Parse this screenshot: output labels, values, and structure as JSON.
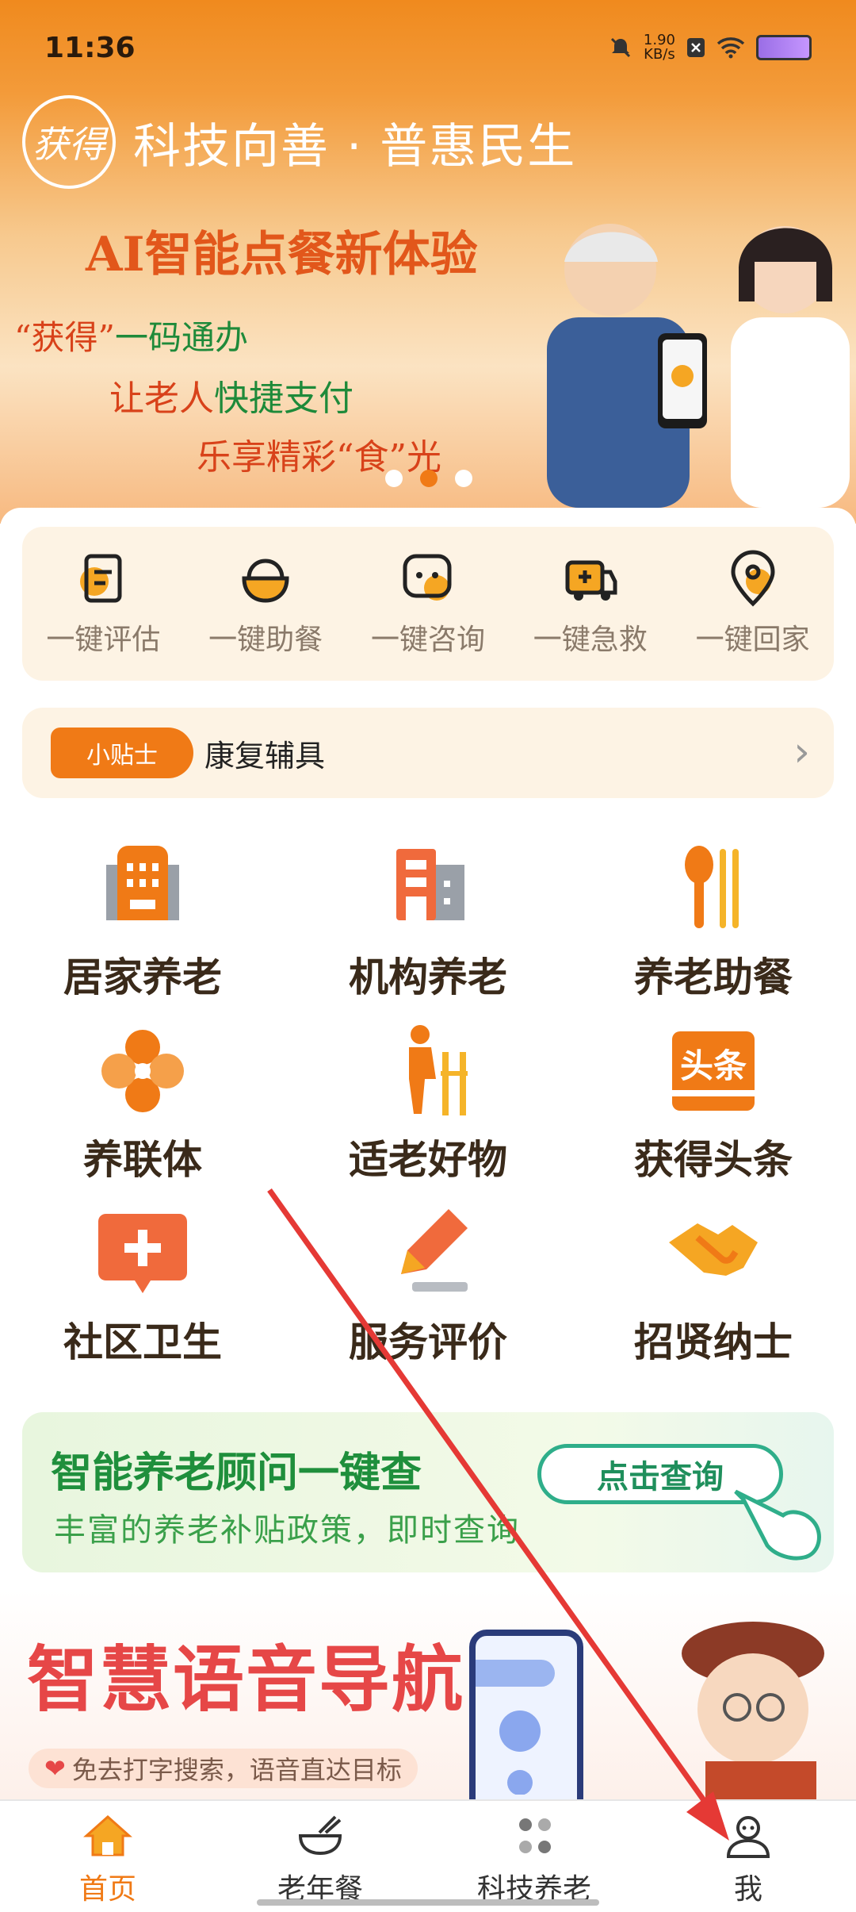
{
  "status_bar": {
    "time": "11:36",
    "net_speed": "1.90",
    "net_unit": "KB/s"
  },
  "banner": {
    "logo_text": "获得",
    "slogan": "科技向善 · 普惠民生",
    "headline": "AI智能点餐新体验",
    "line1_quote": "“获得”",
    "line1_rest": "一码通办",
    "line2_a": "让老人",
    "line2_b": "快捷支付",
    "line3": "乐享精彩“食”光",
    "active_dot": 2
  },
  "quick_actions": [
    {
      "label": "一键评估",
      "icon": "assessment-icon"
    },
    {
      "label": "一键助餐",
      "icon": "meal-bowl-icon"
    },
    {
      "label": "一键咨询",
      "icon": "consult-chat-icon"
    },
    {
      "label": "一键急救",
      "icon": "ambulance-icon"
    },
    {
      "label": "一键回家",
      "icon": "location-pin-icon"
    }
  ],
  "tips": {
    "badge": "小贴士",
    "text": "康复辅具",
    "arrow": "›"
  },
  "services": [
    {
      "label": "居家养老",
      "icon": "home-care-building-icon"
    },
    {
      "label": "机构养老",
      "icon": "institution-building-icon"
    },
    {
      "label": "养老助餐",
      "icon": "spoon-fork-icon"
    },
    {
      "label": "养联体",
      "icon": "flower-clover-icon"
    },
    {
      "label": "适老好物",
      "icon": "elder-walker-icon"
    },
    {
      "label": "获得头条",
      "icon": "headline-icon"
    },
    {
      "label": "社区卫生",
      "icon": "medical-cross-icon"
    },
    {
      "label": "服务评价",
      "icon": "pen-icon"
    },
    {
      "label": "招贤纳士",
      "icon": "handshake-icon"
    }
  ],
  "headline_icon_text": "头条",
  "advisor": {
    "title": "智能养老顾问一键查",
    "subtitle": "丰富的养老补贴政策，即时查询",
    "button": "点击查询"
  },
  "voice_nav": {
    "title": "智慧语音导航",
    "hint": "免去打字搜索，语音直达目标"
  },
  "bottom_nav": [
    {
      "label": "首页",
      "icon": "home-icon",
      "active": true
    },
    {
      "label": "老年餐",
      "icon": "bowl-chopsticks-icon",
      "active": false
    },
    {
      "label": "科技养老",
      "icon": "dots-cluster-icon",
      "active": false
    },
    {
      "label": "我",
      "icon": "profile-icon",
      "active": false
    }
  ],
  "colors": {
    "brand_orange": "#f07a16",
    "green": "#1f8f3c",
    "red": "#e64747"
  }
}
